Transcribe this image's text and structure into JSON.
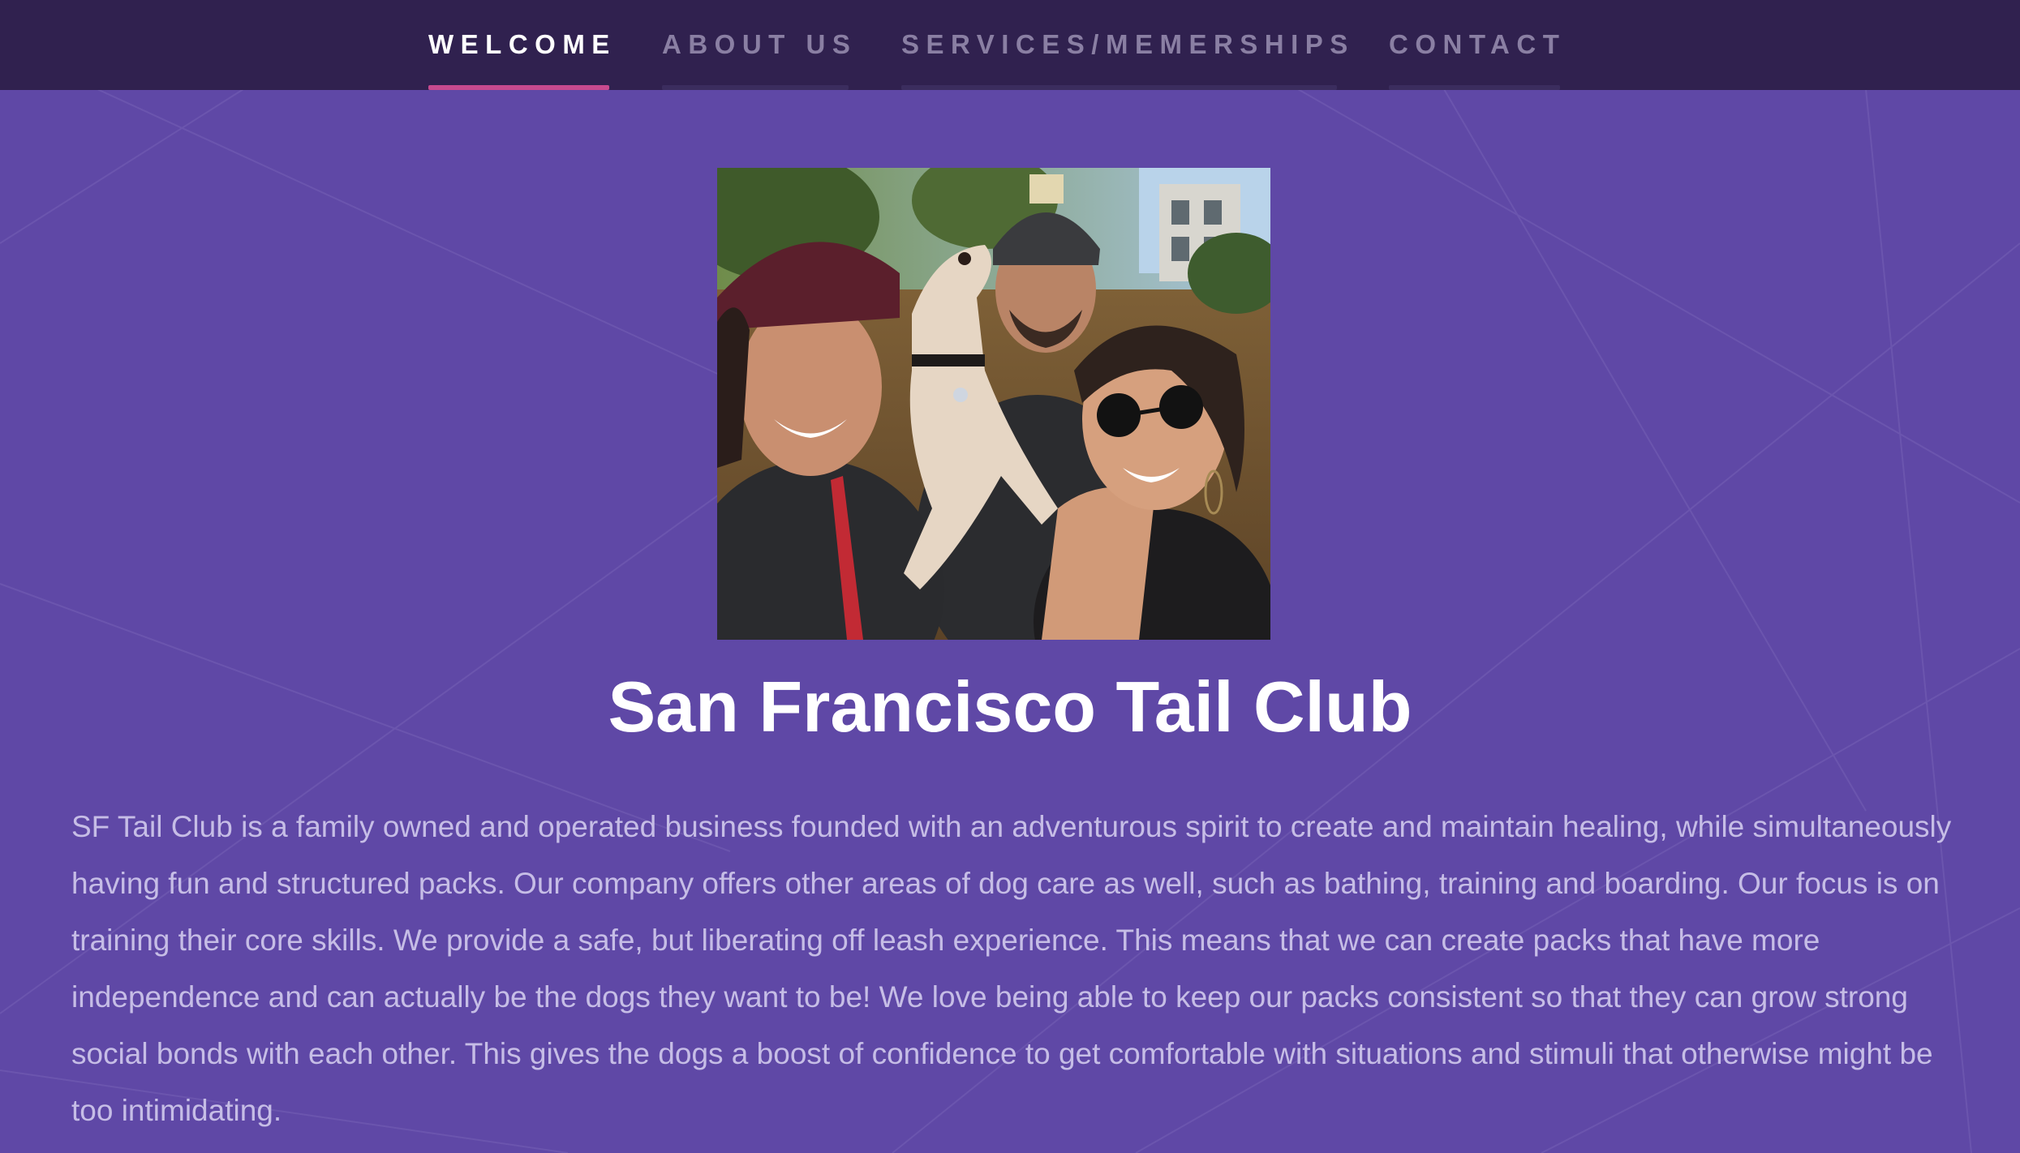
{
  "nav": {
    "items": [
      {
        "label": "WELCOME",
        "active": true
      },
      {
        "label": "ABOUT US",
        "active": false
      },
      {
        "label": "SERVICES/MEMERSHIPS",
        "active": false
      },
      {
        "label": "CONTACT",
        "active": false
      }
    ]
  },
  "hero": {
    "photo_icon": "group-photo-with-dog-icon"
  },
  "main": {
    "title": "San Francisco Tail Club",
    "body": "SF Tail Club is a family owned and operated business founded with an adventurous spirit to create and maintain healing, while simultaneously having fun and structured packs. Our company offers other areas of dog care as well, such as bathing, training and boarding. Our focus is on training their core skills. We provide a safe, but liberating off leash experience. This means that we can create packs that have more independence and can actually be the dogs they want to be! We love being able to keep our packs consistent so that they can grow strong social bonds with each other. This gives the dogs a boost of confidence to get comfortable with situations and stimuli that otherwise might be too intimidating."
  },
  "colors": {
    "nav_background": "#30214f",
    "page_background": "#5f48a6",
    "active_underline": "#c74a8f",
    "inactive_nav_text": "#8a7fa3",
    "body_text": "#c6bde6"
  }
}
